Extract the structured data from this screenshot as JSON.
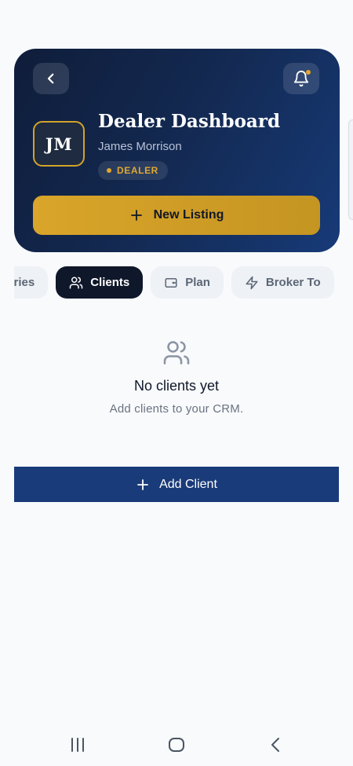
{
  "header": {
    "title": "Dealer Dashboard",
    "user_name": "James Morrison",
    "avatar_initials": "JM",
    "role_badge": "DEALER",
    "new_listing_label": "New Listing",
    "back_icon": "chevron-left-icon",
    "bell_icon": "bell-icon",
    "notification_indicator": true
  },
  "tabs": [
    {
      "label": "Enquiries",
      "visible_text": "quiries",
      "icon": "none",
      "active": false
    },
    {
      "label": "Clients",
      "icon": "users-icon",
      "active": true
    },
    {
      "label": "Plan",
      "icon": "wallet-icon",
      "active": false
    },
    {
      "label": "Broker To",
      "icon": "bolt-icon",
      "active": false
    }
  ],
  "empty_state": {
    "icon": "users-icon",
    "title": "No clients yet",
    "subtitle": "Add clients to your CRM."
  },
  "add_client_label": "Add Client",
  "system_nav": {
    "recents_icon": "recents-icon",
    "home_icon": "home-icon",
    "back_icon": "back-icon"
  },
  "colors": {
    "header_start": "#0f1d3a",
    "header_end": "#173a78",
    "gold": "#d9a52a",
    "active_tab": "#0f172a",
    "primary_button": "#1a3b79",
    "background": "#f8fafc"
  }
}
